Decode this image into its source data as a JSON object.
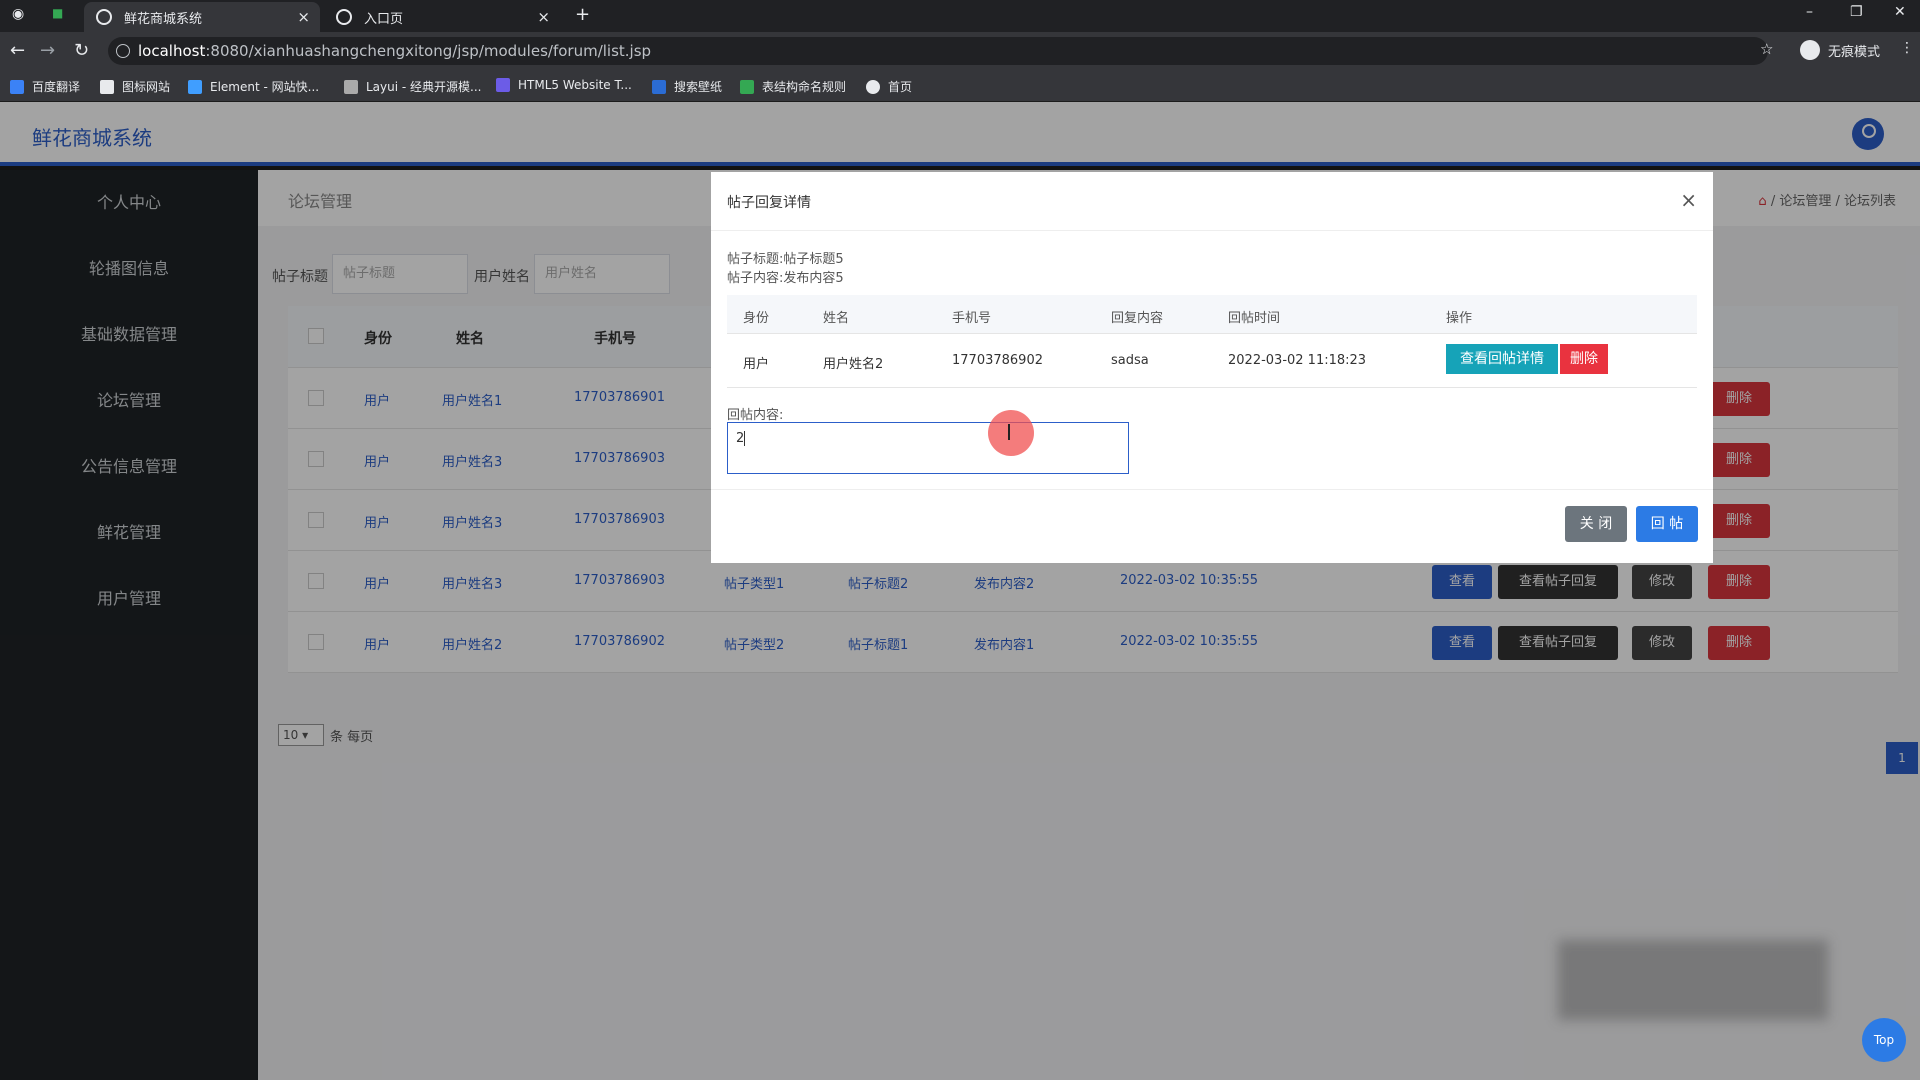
{
  "browser": {
    "tabs": [
      {
        "label": "鲜花商城系统"
      },
      {
        "label": "入口页"
      }
    ],
    "url_host": "localhost",
    "url_path": ":8080/xianhuashangchengxitong/jsp/modules/forum/list.jsp",
    "incognito_label": "无痕模式",
    "bookmarks": [
      "百度翻译",
      "图标网站",
      "Element - 网站快...",
      "Layui - 经典开源模...",
      "HTML5 Website T...",
      "搜索壁纸",
      "表结构命名规则",
      "首页"
    ]
  },
  "app": {
    "title": "鲜花商城系统",
    "sidebar": [
      "个人中心",
      "轮播图信息",
      "基础数据管理",
      "论坛管理",
      "公告信息管理",
      "鲜花管理",
      "用户管理"
    ],
    "page_title": "论坛管理",
    "breadcrumb": "/ 论坛管理 / 论坛列表",
    "search": {
      "title_label": "帖子标题",
      "title_placeholder": "帖子标题",
      "user_label": "用户姓名",
      "user_placeholder": "用户姓名"
    },
    "table": {
      "headers": [
        "身份",
        "姓名",
        "手机号"
      ],
      "rows": [
        {
          "role": "用户",
          "name": "用户姓名1",
          "phone": "17703786901",
          "type": "",
          "title": "",
          "content": "",
          "time": ""
        },
        {
          "role": "用户",
          "name": "用户姓名3",
          "phone": "17703786903",
          "type": "",
          "title": "",
          "content": "",
          "time": ""
        },
        {
          "role": "用户",
          "name": "用户姓名3",
          "phone": "17703786903",
          "type": "",
          "title": "",
          "content": "",
          "time": ""
        },
        {
          "role": "用户",
          "name": "用户姓名3",
          "phone": "17703786903",
          "type": "帖子类型1",
          "title": "帖子标题2",
          "content": "发布内容2",
          "time": "2022-03-02 10:35:55"
        },
        {
          "role": "用户",
          "name": "用户姓名2",
          "phone": "17703786902",
          "type": "帖子类型2",
          "title": "帖子标题1",
          "content": "发布内容1",
          "time": "2022-03-02 10:35:55"
        }
      ],
      "actions": {
        "view": "查看",
        "view_replies": "查看帖子回复",
        "edit": "修改",
        "delete": "删除"
      }
    },
    "page_size": "10",
    "page_size_suffix": "条 每页",
    "current_page": "1",
    "top_button": "Top"
  },
  "modal": {
    "title": "帖子回复详情",
    "post_title_line": "帖子标题:帖子标题5",
    "post_content_line": "帖子内容:发布内容5",
    "headers": [
      "身份",
      "姓名",
      "手机号",
      "回复内容",
      "回帖时间",
      "操作"
    ],
    "rows": [
      {
        "role": "用户",
        "name": "用户姓名2",
        "phone": "17703786902",
        "content": "sadsa",
        "time": "2022-03-02 11:18:23"
      }
    ],
    "detail_button": "查看回帖详情",
    "delete_button": "删除",
    "reply_label": "回帖内容:",
    "reply_value": "2",
    "close_button": "关 闭",
    "submit_button": "回 帖"
  },
  "colors": {
    "accent": "#2c5ec9",
    "danger": "#d9363e",
    "info": "#16a3b8"
  }
}
